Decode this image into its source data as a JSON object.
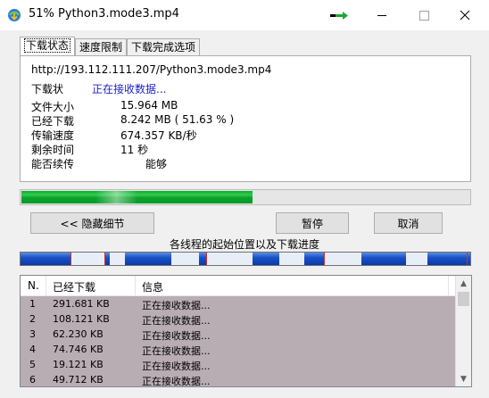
{
  "window": {
    "title": "51% Python3.mode3.mp4"
  },
  "tabs": [
    "下载状态",
    "速度限制",
    "下载完成选项"
  ],
  "status": {
    "url": "http://193.112.111.207/Python3.mode3.mp4",
    "status_label": "下载状",
    "status_value": "正在接收数据...",
    "file_size_label": "文件大小",
    "file_size_value": "15.964  MB",
    "downloaded_label": "已经下载",
    "downloaded_value": "8.242  MB  ( 51.63 % )",
    "speed_label": "传输速度",
    "speed_value": "674.357  KB/秒",
    "remaining_label": "剩余时间",
    "remaining_value": "11 秒",
    "resume_label": "能否续传",
    "resume_value": "能够"
  },
  "progress": {
    "percent": 51.63,
    "color": "#06b025"
  },
  "buttons": {
    "hide_details": "<< 隐藏细节",
    "pause": "暂停",
    "cancel": "取消"
  },
  "threads_label": "各线程的起始位置以及下载进度",
  "list": {
    "headers": [
      "N.",
      "已经下载",
      "信息"
    ],
    "rows": [
      {
        "n": "1",
        "downloaded": "291.681  KB",
        "info": "正在接收数据..."
      },
      {
        "n": "2",
        "downloaded": "108.121  KB",
        "info": "正在接收数据..."
      },
      {
        "n": "3",
        "downloaded": "62.230  KB",
        "info": "正在接收数据..."
      },
      {
        "n": "4",
        "downloaded": "74.746  KB",
        "info": "正在接收数据..."
      },
      {
        "n": "5",
        "downloaded": "19.121  KB",
        "info": "正在接收数据..."
      },
      {
        "n": "6",
        "downloaded": "49.712  KB",
        "info": "正在接收数据..."
      }
    ]
  }
}
